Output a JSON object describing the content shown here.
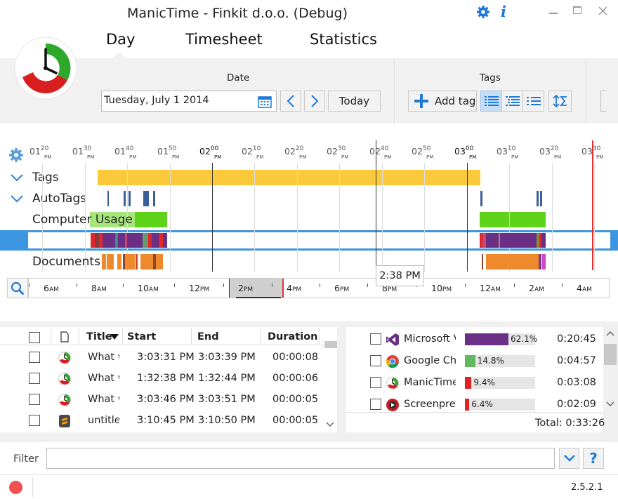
{
  "window": {
    "title": "ManicTime - Finkit d.o.o. (Debug)"
  },
  "nav": {
    "tabs": [
      {
        "label": "Day"
      },
      {
        "label": "Timesheet"
      },
      {
        "label": "Statistics"
      }
    ]
  },
  "toolbar": {
    "date_label": "Date",
    "date_value": "Tuesday, July 1 2014",
    "today_label": "Today",
    "tags_label": "Tags",
    "add_tag_label": "Add tag"
  },
  "timeline": {
    "ticks": [
      {
        "h": "01",
        "m": "20",
        "pm": "PM"
      },
      {
        "h": "01",
        "m": "30",
        "pm": "PM"
      },
      {
        "h": "01",
        "m": "40",
        "pm": "PM"
      },
      {
        "h": "01",
        "m": "50",
        "pm": "PM"
      },
      {
        "h": "02",
        "m": "00",
        "pm": "PM"
      },
      {
        "h": "02",
        "m": "10",
        "pm": "PM"
      },
      {
        "h": "02",
        "m": "20",
        "pm": "PM"
      },
      {
        "h": "02",
        "m": "30",
        "pm": "PM"
      },
      {
        "h": "02",
        "m": "40",
        "pm": "PM"
      },
      {
        "h": "02",
        "m": "50",
        "pm": "PM"
      },
      {
        "h": "03",
        "m": "00",
        "pm": "PM"
      },
      {
        "h": "03",
        "m": "10",
        "pm": "PM"
      },
      {
        "h": "03",
        "m": "20",
        "pm": "PM"
      },
      {
        "h": "03",
        "m": "30",
        "pm": "PM"
      }
    ],
    "rows": {
      "tags": "Tags",
      "autotags": "AutoTags",
      "computer_usage": "Computer Usage",
      "documents": "Documents"
    },
    "tooltip": "2:38 PM",
    "overview_labels": [
      {
        "t": "6",
        "s": "AM"
      },
      {
        "t": "8",
        "s": "AM"
      },
      {
        "t": "10",
        "s": "AM"
      },
      {
        "t": "12",
        "s": "PM"
      },
      {
        "t": "2",
        "s": "PM"
      },
      {
        "t": "4",
        "s": "PM"
      },
      {
        "t": "6",
        "s": "PM"
      },
      {
        "t": "8",
        "s": "PM"
      },
      {
        "t": "10",
        "s": "PM"
      },
      {
        "t": "12",
        "s": "AM"
      },
      {
        "t": "2",
        "s": "AM"
      },
      {
        "t": "4",
        "s": "AM"
      }
    ],
    "colors": {
      "tags": "#fcc93a",
      "autotags": "#3b5f9d",
      "usage": "#5fd21a",
      "usage_light": "#a6e57c",
      "purple": "#6b2f86",
      "red": "#e02828",
      "orange": "#ee8a2b",
      "selected": "#3c95e1",
      "now": "#e03030"
    }
  },
  "table": {
    "headers": {
      "title": "Title",
      "start": "Start",
      "end": "End",
      "duration": "Duration"
    },
    "rows": [
      {
        "icon": "manictime-icon",
        "title": "What w",
        "start": "3:03:31 PM",
        "end": "3:03:39 PM",
        "duration": "00:00:08"
      },
      {
        "icon": "manictime-icon",
        "title": "What w",
        "start": "1:32:38 PM",
        "end": "1:32:44 PM",
        "duration": "00:00:06"
      },
      {
        "icon": "manictime-icon",
        "title": "What w",
        "start": "3:03:46 PM",
        "end": "3:03:51 PM",
        "duration": "00:00:05"
      },
      {
        "icon": "sublime-icon",
        "title": "untitle",
        "start": "3:10:45 PM",
        "end": "3:10:50 PM",
        "duration": "00:00:05"
      }
    ]
  },
  "apps": {
    "rows": [
      {
        "icon": "visual-studio-icon",
        "name": "Microsoft Vi",
        "percent": 62.1,
        "percent_label": "62.1%",
        "time": "0:20:45",
        "color": "#6b2f86"
      },
      {
        "icon": "chrome-icon",
        "name": "Google Chr",
        "percent": 14.8,
        "percent_label": "14.8%",
        "time": "0:04:57",
        "color": "#62b85e"
      },
      {
        "icon": "manictime-icon",
        "name": "ManicTime",
        "percent": 9.4,
        "percent_label": "9.4%",
        "time": "0:03:08",
        "color": "#e02222"
      },
      {
        "icon": "screenpresso-icon",
        "name": "Screenpres",
        "percent": 6.4,
        "percent_label": "6.4%",
        "time": "0:02:09",
        "color": "#e02222"
      }
    ],
    "total": "Total: 0:33:26"
  },
  "filter": {
    "label": "Filter",
    "value": ""
  },
  "version": "2.5.2.1"
}
